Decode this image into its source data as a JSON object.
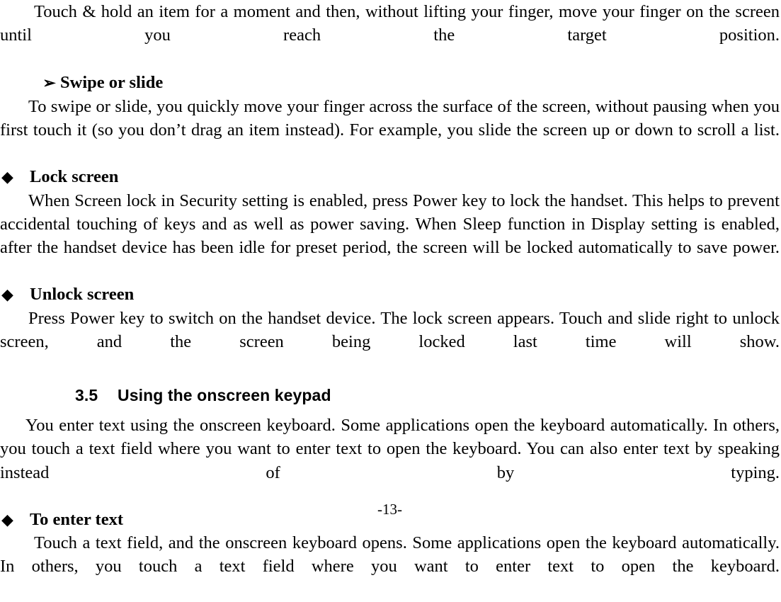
{
  "document": {
    "page_number_label": "-13-"
  },
  "bullets": {
    "diamond": "◆",
    "arrow": "➢"
  },
  "blocks": {
    "touch_and_hold_paragraph": "Touch & hold an item for a moment and then, without lifting your finger, move your finger on the screen until you reach the target position.",
    "swipe_or_slide_heading": "Swipe or slide",
    "swipe_or_slide_paragraph": "To swipe or slide, you quickly move your finger across the surface of the screen, without pausing when you first touch it (so you don’t drag an item instead). For example, you slide the screen up or down to scroll a list.",
    "lock_screen_heading": "Lock screen",
    "lock_screen_paragraph": "When Screen lock in Security setting is enabled, press Power key to lock the handset. This helps to prevent accidental touching of keys and as well as power saving. When Sleep function in Display setting is enabled, after the handset device has been idle for preset period, the screen will be locked automatically to save power.",
    "unlock_screen_heading": "Unlock screen",
    "unlock_screen_paragraph": "Press Power key to switch on the handset device. The lock screen appears. Touch and slide right to unlock screen, and the screen being locked last time will show.",
    "section_number": "3.5",
    "section_title": "Using the onscreen keypad",
    "onscreen_keypad_paragraph": "You enter text using the onscreen keyboard. Some applications open the keyboard automatically. In others, you touch a text field where you want to enter text to open the keyboard. You can also enter text by speaking instead of by typing.",
    "to_enter_text_heading": "To enter text",
    "to_enter_text_paragraph": "Touch a text field, and the onscreen keyboard opens. Some applications open the keyboard automatically. In others, you touch a text field where you want to enter text to open the keyboard."
  }
}
